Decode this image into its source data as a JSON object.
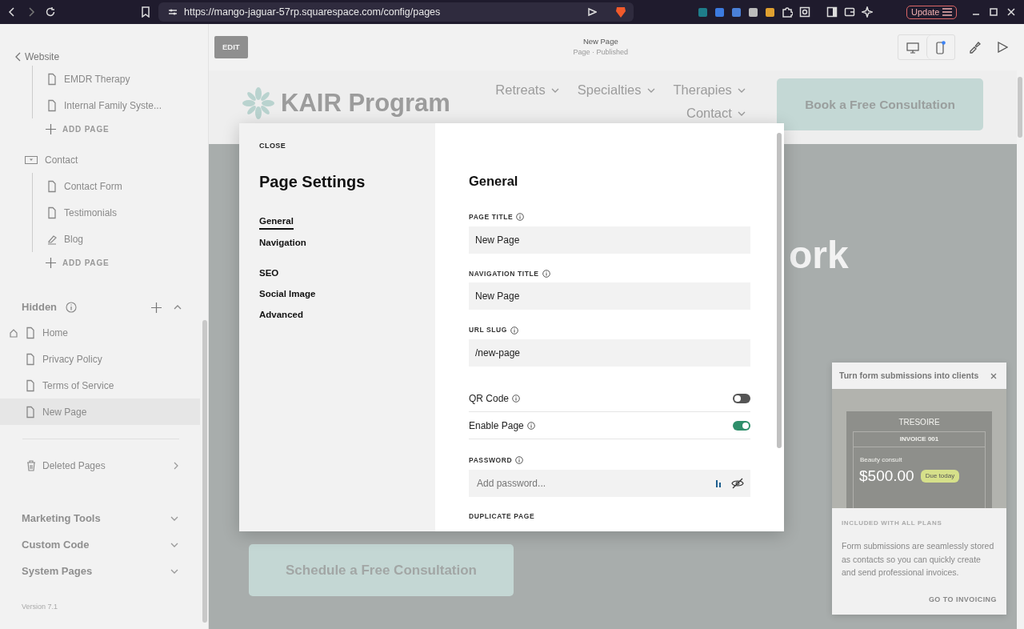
{
  "browser": {
    "url": "https://mango-jaguar-57rp.squarespace.com/config/pages",
    "update_label": "Update"
  },
  "sidebar": {
    "back": "Website",
    "tree": [
      {
        "children": [
          {
            "label": "EMDR Therapy",
            "kind": "page"
          },
          {
            "label": "Internal Family Syste...",
            "kind": "page"
          }
        ],
        "add_label": "ADD PAGE"
      },
      {
        "label": "Contact",
        "kind": "folder",
        "children": [
          {
            "label": "Contact Form",
            "kind": "page"
          },
          {
            "label": "Testimonials",
            "kind": "page"
          },
          {
            "label": "Blog",
            "kind": "blog"
          }
        ],
        "add_label": "ADD PAGE"
      }
    ],
    "hidden": {
      "title": "Hidden",
      "expanded": true,
      "items": [
        {
          "label": "Home",
          "home": true,
          "selected": false
        },
        {
          "label": "Privacy Policy",
          "home": false,
          "selected": false
        },
        {
          "label": "Terms of Service",
          "home": false,
          "selected": false
        },
        {
          "label": "New Page",
          "home": false,
          "selected": true
        }
      ]
    },
    "deleted": "Deleted Pages",
    "sections": [
      {
        "label": "Marketing Tools",
        "expanded": false
      },
      {
        "label": "Custom Code",
        "expanded": false
      },
      {
        "label": "System Pages",
        "expanded": false
      }
    ],
    "version": "Version 7.1"
  },
  "header": {
    "edit": "EDIT",
    "page_title": "New Page",
    "page_status": "Page · Published"
  },
  "site": {
    "logo": "KAIR Program",
    "nav": [
      "Retreats",
      "Specialties",
      "Therapies",
      "Contact"
    ],
    "cta": "Book a Free Consultation",
    "hero_fragment": "ork",
    "hero_button": "Schedule a Free Consultation"
  },
  "modal": {
    "close": "CLOSE",
    "title": "Page Settings",
    "nav_groups": [
      [
        {
          "label": "General",
          "selected": true
        },
        {
          "label": "Navigation",
          "selected": false
        }
      ],
      [
        {
          "label": "SEO",
          "selected": false
        },
        {
          "label": "Social Image",
          "selected": false
        },
        {
          "label": "Advanced",
          "selected": false
        }
      ]
    ],
    "section": "General",
    "fields": [
      {
        "label": "PAGE TITLE",
        "value": "New Page"
      },
      {
        "label": "NAVIGATION TITLE",
        "value": "New Page"
      },
      {
        "label": "URL SLUG",
        "value": "/new-page"
      }
    ],
    "toggles": [
      {
        "label": "QR Code",
        "on": false
      },
      {
        "label": "Enable Page",
        "on": true
      }
    ],
    "password": {
      "label": "PASSWORD",
      "placeholder": "Add password..."
    },
    "next_section": "DUPLICATE PAGE"
  },
  "promo": {
    "title": "Turn form submissions into clients",
    "invoice": {
      "brand": "TRESOIRE",
      "number": "INVOICE 001",
      "item": "Beauty consult",
      "amount": "$500.00",
      "badge": "Due today"
    },
    "eyebrow": "INCLUDED WITH ALL PLANS",
    "body": "Form submissions are seamlessly stored as contacts so you can quickly create and send professional invoices.",
    "link": "GO TO INVOICING"
  }
}
